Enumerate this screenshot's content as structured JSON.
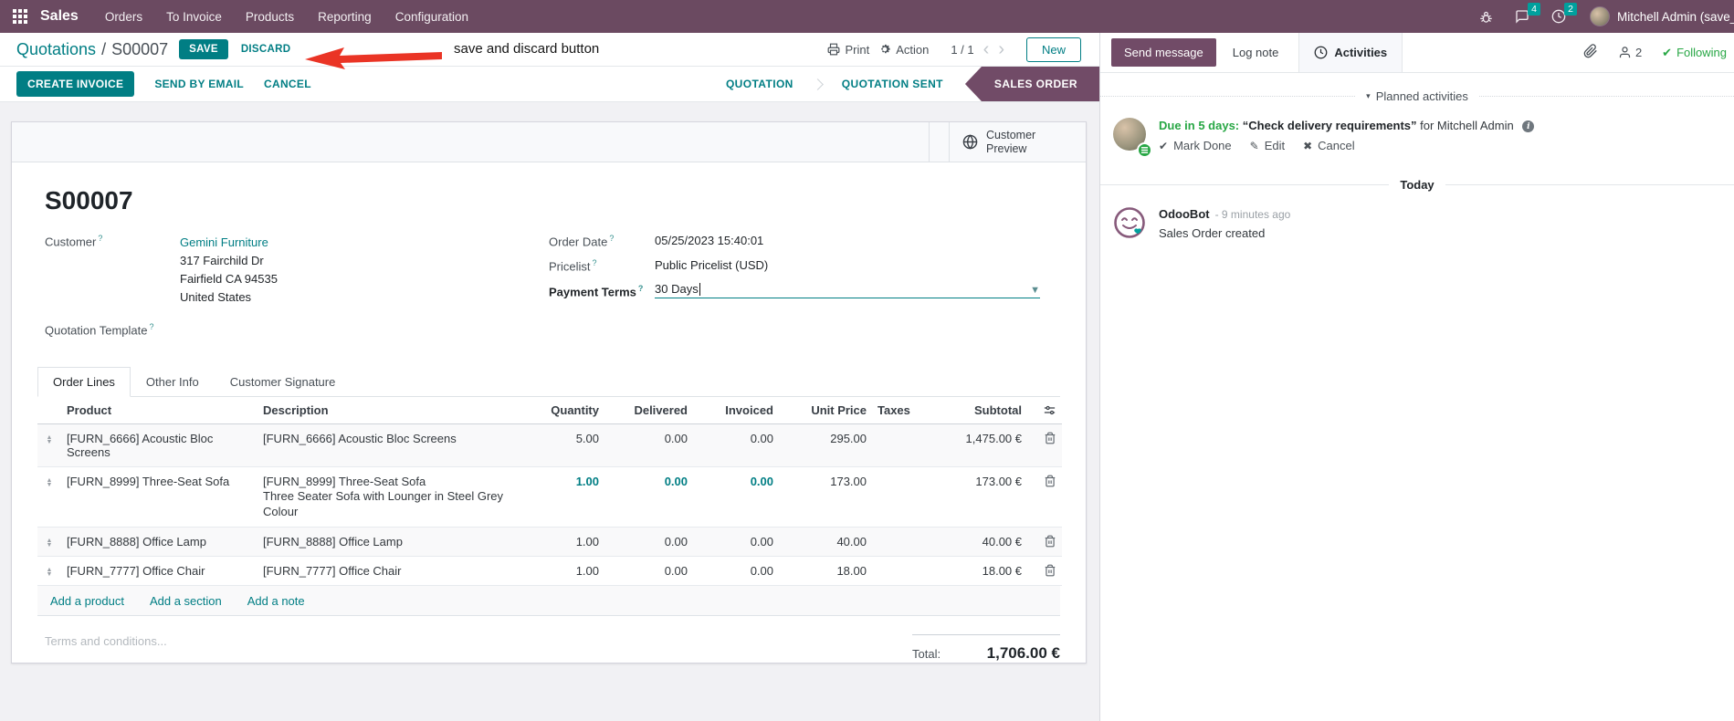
{
  "navbar": {
    "app_name": "Sales",
    "menus": [
      "Orders",
      "To Invoice",
      "Products",
      "Reporting",
      "Configuration"
    ],
    "messages_count": "4",
    "activities_count": "2",
    "user_name": "Mitchell Admin (save_discar"
  },
  "control_panel": {
    "breadcrumb_parent": "Quotations",
    "breadcrumb_separator": "/",
    "breadcrumb_current": "S00007",
    "save_label": "SAVE",
    "discard_label": "DISCARD",
    "annotation": "save and discard button",
    "print_label": "Print",
    "action_label": "Action",
    "pager": "1 / 1",
    "new_label": "New"
  },
  "statusbar": {
    "buttons": [
      "CREATE INVOICE",
      "SEND BY EMAIL",
      "CANCEL"
    ],
    "stages": [
      {
        "label": "QUOTATION",
        "active": false
      },
      {
        "label": "QUOTATION SENT",
        "active": false
      },
      {
        "label": "SALES ORDER",
        "active": true
      }
    ]
  },
  "form": {
    "customer_preview_label": "Customer Preview",
    "title": "S00007",
    "help_marker": "?",
    "customer_label": "Customer",
    "customer_name": "Gemini Furniture",
    "customer_address": [
      "317 Fairchild Dr",
      "Fairfield CA 94535",
      "United States"
    ],
    "quotation_template_label": "Quotation Template",
    "order_date_label": "Order Date",
    "order_date_value": "05/25/2023 15:40:01",
    "pricelist_label": "Pricelist",
    "pricelist_value": "Public Pricelist (USD)",
    "payment_terms_label": "Payment Terms",
    "payment_terms_value": "30 Days",
    "tabs": [
      "Order Lines",
      "Other Info",
      "Customer Signature"
    ],
    "table": {
      "headers": [
        "Product",
        "Description",
        "Quantity",
        "Delivered",
        "Invoiced",
        "Unit Price",
        "Taxes",
        "Subtotal"
      ],
      "rows": [
        {
          "product": "[FURN_6666] Acoustic Bloc Screens",
          "description": "[FURN_6666] Acoustic Bloc Screens",
          "description2": "",
          "quantity": "5.00",
          "delivered": "0.00",
          "invoiced": "0.00",
          "unit_price": "295.00",
          "taxes": "",
          "subtotal": "1,475.00 €"
        },
        {
          "product": "[FURN_8999] Three-Seat Sofa",
          "description": "[FURN_8999] Three-Seat Sofa",
          "description2": "Three Seater Sofa with Lounger in Steel Grey Colour",
          "quantity": "1.00",
          "delivered": "0.00",
          "invoiced": "0.00",
          "unit_price": "173.00",
          "taxes": "",
          "subtotal": "173.00 €"
        },
        {
          "product": "[FURN_8888] Office Lamp",
          "description": "[FURN_8888] Office Lamp",
          "description2": "",
          "quantity": "1.00",
          "delivered": "0.00",
          "invoiced": "0.00",
          "unit_price": "40.00",
          "taxes": "",
          "subtotal": "40.00 €"
        },
        {
          "product": "[FURN_7777] Office Chair",
          "description": "[FURN_7777] Office Chair",
          "description2": "",
          "quantity": "1.00",
          "delivered": "0.00",
          "invoiced": "0.00",
          "unit_price": "18.00",
          "taxes": "",
          "subtotal": "18.00 €"
        }
      ],
      "footer_links": [
        "Add a product",
        "Add a section",
        "Add a note"
      ]
    },
    "terms_placeholder": "Terms and conditions...",
    "total_label": "Total:",
    "total_value": "1,706.00 €"
  },
  "chatter": {
    "send_message_label": "Send message",
    "log_note_label": "Log note",
    "activities_label": "Activities",
    "followers_count": "2",
    "following_label": "Following",
    "planned_activities_label": "Planned activities",
    "activity": {
      "due": "Due in 5 days:",
      "summary": "“Check delivery requirements”",
      "assignee": "for Mitchell Admin",
      "actions": [
        "Mark Done",
        "Edit",
        "Cancel"
      ]
    },
    "today_label": "Today",
    "message": {
      "author": "OdooBot",
      "time": "- 9 minutes ago",
      "body": "Sales Order created"
    }
  },
  "colors": {
    "brand_purple": "#714b67",
    "accent_teal": "#017e84",
    "badge_teal": "#00a09d",
    "success_green": "#28a745",
    "annotation_red": "#ea3425"
  }
}
